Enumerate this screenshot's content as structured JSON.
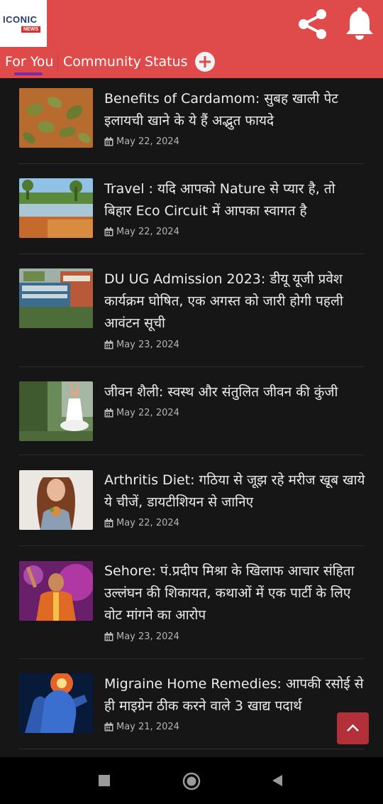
{
  "app": {
    "logo_top": "ICONIC",
    "logo_badge": "NEWS"
  },
  "header": {
    "share_icon": "share-icon",
    "notification_icon": "bell-icon",
    "accent_color": "#df4a4a"
  },
  "tabs": [
    {
      "label": "For You",
      "active": true
    },
    {
      "label": "Community",
      "active": false
    },
    {
      "label": "Status",
      "active": false
    }
  ],
  "add_tab_icon": "plus-circle-icon",
  "articles": [
    {
      "title": "Benefits of Cardamom: सुबह खाली पेट इलायची खाने के ये हैं अद्भुत फायदे",
      "date": "May 22, 2024",
      "thumb": "cardamom"
    },
    {
      "title": "Travel : यदि आपको Nature से प्यार है, तो बिहार Eco Circuit में आपका स्वागत है",
      "date": "May 22, 2024",
      "thumb": "nature"
    },
    {
      "title": "DU UG Admission 2023: डीयू यूजी प्रवेश कार्यक्रम घोषित, एक अगस्त को जारी होगी पहली आवंटन सूची",
      "date": "May 23, 2024",
      "thumb": "university"
    },
    {
      "title": "जीवन शैली: स्वस्थ और संतुलित जीवन की कुंजी",
      "date": "May 22, 2024",
      "thumb": "yoga"
    },
    {
      "title": "Arthritis Diet: गठिया से जूझ रहे मरीज खूब खाये ये चीजें, डायटीशियन से जानिए",
      "date": "May 22, 2024",
      "thumb": "diet"
    },
    {
      "title": "Sehore: पं.प्रदीप मिश्रा के खिलाफ आचार संहिता उल्लंघन की शिकायत, कथाओं में एक पार्टी के लिए वोट मांगने का आरोप",
      "date": "May 23, 2024",
      "thumb": "preacher"
    },
    {
      "title": "Migraine Home Remedies: आपकी रसोई से ही माइग्रेन ठीक करने वाले 3 खाद्य पदार्थ",
      "date": "May 21, 2024",
      "thumb": "migraine"
    }
  ],
  "date_icon": "calendar-icon",
  "scroll_top_icon": "chevron-up-icon",
  "navbar": {
    "recent_icon": "square-icon",
    "home_icon": "circle-icon",
    "back_icon": "triangle-back-icon"
  }
}
